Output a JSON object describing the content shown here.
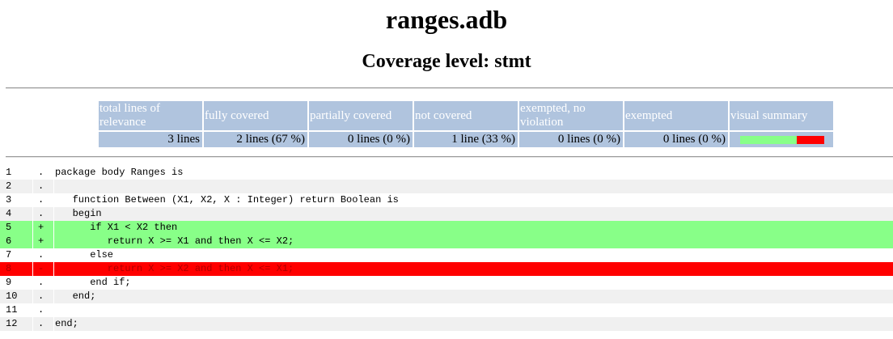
{
  "page": {
    "title": "ranges.adb",
    "subtitle": "Coverage level: stmt"
  },
  "summary": {
    "headers": [
      "total lines of relevance",
      "fully covered",
      "partially covered",
      "not covered",
      "exempted, no violation",
      "exempted",
      "visual summary"
    ],
    "values": [
      "3 lines",
      "2 lines (67 %)",
      "0 lines (0 %)",
      "1 line (33 %)",
      "0 lines (0 %)",
      "0 lines (0 %)"
    ],
    "visual": {
      "fully_covered_fraction": 0.67,
      "partially_covered_fraction": 0.0,
      "not_covered_fraction": 0.33
    }
  },
  "colors": {
    "header_bg": "#b0c4de",
    "covered": "#88ff88",
    "not_covered": "#ff0000",
    "alt_row": "#f0f0f0"
  },
  "source": {
    "lines": [
      {
        "num": "1",
        "mark": ".",
        "code": "package body Ranges is",
        "state": "plain"
      },
      {
        "num": "2",
        "mark": ".",
        "code": "",
        "state": "alt"
      },
      {
        "num": "3",
        "mark": ".",
        "code": "   function Between (X1, X2, X : Integer) return Boolean is",
        "state": "plain"
      },
      {
        "num": "4",
        "mark": ".",
        "code": "   begin",
        "state": "alt"
      },
      {
        "num": "5",
        "mark": "+",
        "code": "      if X1 < X2 then",
        "state": "covered"
      },
      {
        "num": "6",
        "mark": "+",
        "code": "         return X >= X1 and then X <= X2;",
        "state": "covered"
      },
      {
        "num": "7",
        "mark": ".",
        "code": "      else",
        "state": "plain"
      },
      {
        "num": "8",
        "mark": "-",
        "code": "         return X >= X2 and then X <= X1;",
        "state": "notcovered"
      },
      {
        "num": "9",
        "mark": ".",
        "code": "      end if;",
        "state": "plain"
      },
      {
        "num": "10",
        "mark": ".",
        "code": "   end;",
        "state": "alt"
      },
      {
        "num": "11",
        "mark": ".",
        "code": "",
        "state": "plain"
      },
      {
        "num": "12",
        "mark": ".",
        "code": "end;",
        "state": "alt"
      }
    ]
  }
}
